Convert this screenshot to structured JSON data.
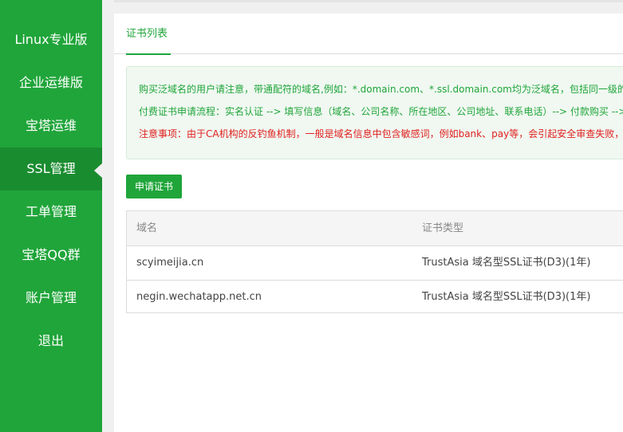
{
  "sidebar": {
    "items": [
      {
        "label": "Linux专业版"
      },
      {
        "label": "企业运维版"
      },
      {
        "label": "宝塔运维"
      },
      {
        "label": "SSL管理"
      },
      {
        "label": "工单管理"
      },
      {
        "label": "宝塔QQ群"
      },
      {
        "label": "账户管理"
      },
      {
        "label": "退出"
      }
    ],
    "active_index": 3
  },
  "main": {
    "tab_label": "证书列表",
    "notice": {
      "line1": "购买泛域名的用户请注意，带通配符的域名,例如：*.domain.com、*.ssl.domain.com均为泛域名，包括同一级的全",
      "line2": "付费证书申请流程：实名认证 --> 填写信息（域名、公司名称、所在地区、公司地址、联系电话）--> 付款购买 -->",
      "line3": "注意事项：由于CA机构的反钓鱼机制，一般是域名信息中包含敏感词，例如bank、pay等，会引起安全审查失败，"
    },
    "apply_button": "申请证书",
    "table": {
      "headers": [
        "域名",
        "证书类型"
      ],
      "rows": [
        [
          "scyimeijia.cn",
          "TrustAsia 域名型SSL证书(D3)(1年)"
        ],
        [
          "negin.wechatapp.net.cn",
          "TrustAsia 域名型SSL证书(D3)(1年)"
        ]
      ]
    }
  },
  "colors": {
    "brand_green": "#20a53a",
    "active_green": "#1a8c30",
    "notice_text": "#20a53a",
    "warning_text": "#e02020"
  }
}
